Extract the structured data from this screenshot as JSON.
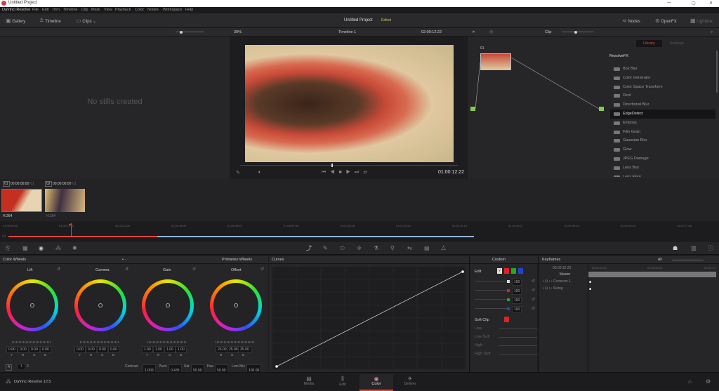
{
  "window": {
    "title": "Untitled Project",
    "controls": [
      "—",
      "▢",
      "✕"
    ]
  },
  "menu": [
    "DaVinci Resolve",
    "File",
    "Edit",
    "Trim",
    "Timeline",
    "Clip",
    "Mark",
    "View",
    "Playback",
    "Color",
    "Nodes",
    "Workspace",
    "Help"
  ],
  "toolbar": {
    "gallery": "Gallery",
    "timeline": "Timeline",
    "clips": "Clips",
    "project": "Untitled Project",
    "status": "Edited",
    "nodes": "Nodes",
    "openfx": "OpenFX",
    "lightbox": "Lightbox"
  },
  "viewer": {
    "zoom": "39%",
    "timeline_name": "Timeline 1",
    "timecode": "02:00:12:22",
    "clip_mode": "Clip",
    "playhead_tc": "01:00:12:22"
  },
  "gallery": {
    "empty": "No stills created"
  },
  "nodes": {
    "node_label": "01"
  },
  "fx": {
    "tabs": [
      "Library",
      "Settings"
    ],
    "section": "ResolveFX",
    "items": [
      "Box Blur",
      "Color Generator",
      "Color Space Transform",
      "Dent",
      "Directional Blur",
      "EdgeDetect",
      "Emboss",
      "Film Grain",
      "Gaussian Blur",
      "Glow",
      "JPEG Damage",
      "Lens Blur",
      "Lens Flare"
    ],
    "selected": "EdgeDetect"
  },
  "clips": [
    {
      "num": "01",
      "tc": "00:00:00:00",
      "track": "V1",
      "codec": "H.264"
    },
    {
      "num": "02",
      "tc": "00:00:00:00",
      "track": "V1",
      "codec": "H.264"
    }
  ],
  "timeline": {
    "track": "V1",
    "ticks": [
      "01:00:00:00",
      "01:00:11:13",
      "01:00:22:26",
      "01:00:34:09",
      "01:00:45:22",
      "01:00:57:05",
      "01:01:08:18",
      "01:01:20:01",
      "01:01:31:14",
      "01:01:42:27",
      "01:01:54:10",
      "01:02:05:23",
      "01:02:17:06"
    ],
    "progress": 0.32
  },
  "wheels": {
    "title": "Color Wheels",
    "mode": "Primaries Wheels",
    "items": [
      {
        "name": "Lift",
        "values": [
          "0.00",
          "0.00",
          "0.00",
          "0.00"
        ],
        "labels": [
          "Y",
          "R",
          "G",
          "B"
        ]
      },
      {
        "name": "Gamma",
        "values": [
          "0.00",
          "0.00",
          "0.00",
          "0.00"
        ],
        "labels": [
          "Y",
          "R",
          "G",
          "B"
        ]
      },
      {
        "name": "Gain",
        "values": [
          "1.00",
          "1.00",
          "1.00",
          "1.00"
        ],
        "labels": [
          "Y",
          "R",
          "G",
          "B"
        ]
      },
      {
        "name": "Offset",
        "values": [
          "25.00",
          "25.00",
          "25.00"
        ],
        "labels": [
          "R",
          "G",
          "B"
        ]
      }
    ],
    "footer": {
      "a": "A",
      "p1": "1",
      "p2": "2",
      "contrast_l": "Contrast",
      "contrast": "1.000",
      "pivot_l": "Pivot",
      "pivot": "0.435",
      "sat_l": "Sat",
      "sat": "50.00",
      "hue_l": "Hue",
      "hue": "50.00",
      "lum_l": "Lum Mix",
      "lum": "100.00"
    }
  },
  "curves": {
    "title": "Curves",
    "mode": "Custom",
    "edit": "Edit",
    "channels": [
      "Y",
      "R",
      "G",
      "B"
    ],
    "intensities": [
      "100",
      "100",
      "100",
      "100"
    ],
    "soft_clip": "Soft Clip",
    "soft_labels": [
      "Low",
      "Low Soft",
      "High",
      "High Soft"
    ]
  },
  "keyframes": {
    "title": "Keyframes",
    "filter": "All",
    "tc": "00:00:12:22",
    "ticks": [
      "00:00:00:00",
      "00:00:08:22",
      "00:00:17:"
    ],
    "rows": [
      "Master",
      "Corrector 1",
      "Sizing"
    ]
  },
  "bottom": {
    "app": "DaVinci Resolve 12.5",
    "pages": [
      "Media",
      "Edit",
      "Color",
      "Deliver"
    ],
    "active": "Color"
  },
  "colors": {
    "accent": "#e0463c",
    "blue": "#8fb4d8"
  }
}
